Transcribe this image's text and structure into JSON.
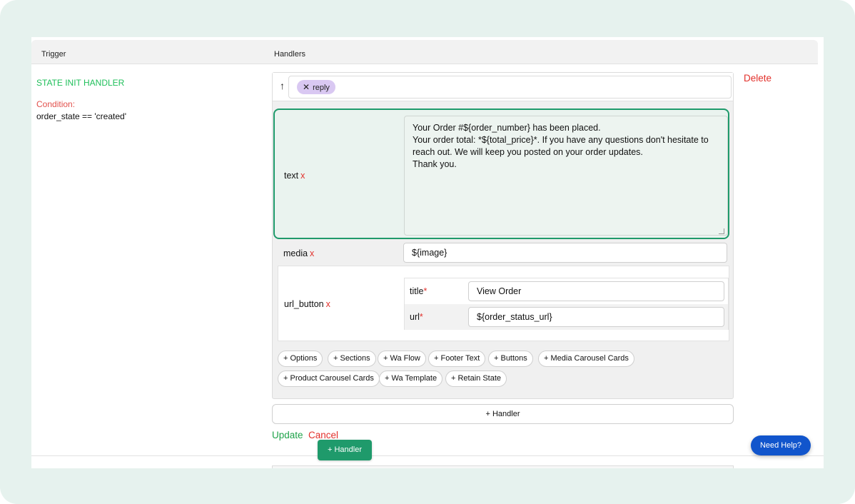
{
  "table": {
    "headers": {
      "trigger": "Trigger",
      "handlers": "Handlers"
    }
  },
  "trigger": {
    "name": "STATE INIT HANDLER",
    "condition_label": "Condition:",
    "condition_value": "order_state == 'created'"
  },
  "actions": {
    "delete": "Delete",
    "update": "Update",
    "cancel": "Cancel"
  },
  "handler": {
    "up_icon": "arrow-up-icon",
    "chip_label": "reply",
    "chip_icon": "close-icon",
    "fields": {
      "text": {
        "label": "text",
        "remove": "x",
        "value": "Your Order #${order_number} has been placed.\nYour order total: *${total_price}*. If you have any questions don't hesitate to reach out. We will keep you posted on your order updates.\nThank you."
      },
      "media": {
        "label": "media",
        "remove": "x",
        "value": "${image}"
      },
      "url_button": {
        "label": "url_button",
        "remove": "x",
        "title_label": "title",
        "title_value": "View Order",
        "url_label": "url",
        "url_value": "${order_status_url}",
        "required_mark": "*"
      }
    },
    "options": [
      "+ Options",
      "+ Sections",
      "+ Wa Flow",
      "+ Footer Text",
      "+ Buttons",
      "+ Media Carousel Cards",
      "+ Product Carousel Cards",
      "+ Wa Template",
      "+ Retain State"
    ]
  },
  "add_handler_wide": "+ Handler",
  "add_handler_green": "+ Handler",
  "need_help": "Need Help?",
  "colors": {
    "accent_green": "#1f9a6b",
    "danger_red": "#e2302b",
    "chip_purple": "#d9c8f2",
    "help_blue": "#1155cc"
  }
}
